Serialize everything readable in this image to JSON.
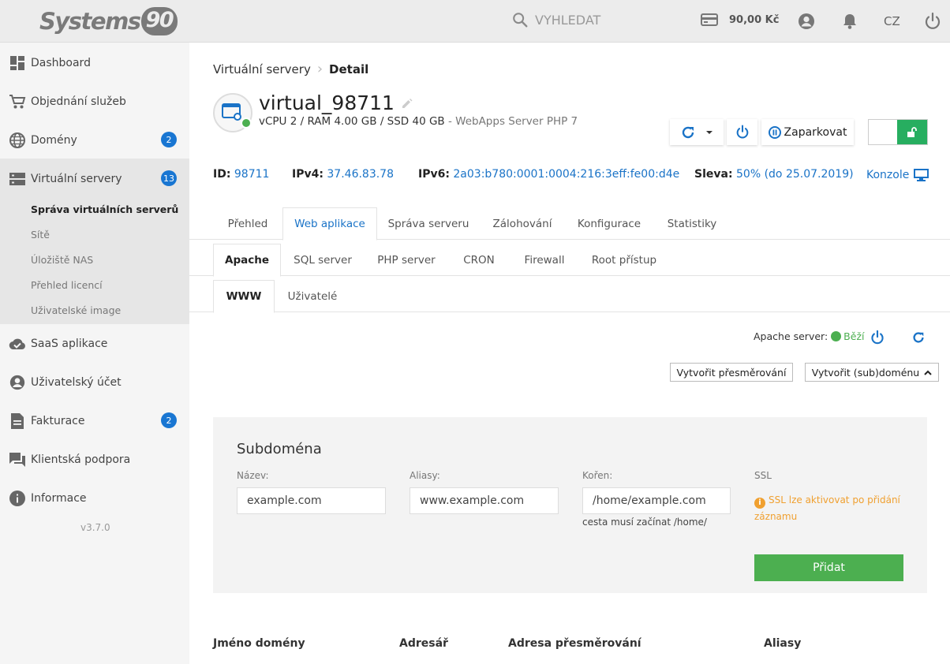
{
  "brand": {
    "logo_text": "Systems",
    "logo_number": "90"
  },
  "topbar": {
    "search_label": "VYHLEDAT",
    "credit": "90,00 Kč",
    "language": "CZ",
    "icons": [
      "search-icon",
      "credit-card-icon",
      "user-icon",
      "bell-icon",
      "power-icon"
    ]
  },
  "sidebar": {
    "items": [
      {
        "label": "Dashboard",
        "icon": "dashboard-icon"
      },
      {
        "label": "Objednání služeb",
        "icon": "cart-icon"
      },
      {
        "label": "Domény",
        "icon": "globe-icon",
        "badge": "2"
      },
      {
        "label": "Virtuální servery",
        "icon": "server-icon",
        "badge": "13"
      },
      {
        "label": "SaaS aplikace",
        "icon": "cloud-icon"
      },
      {
        "label": "Uživatelský účet",
        "icon": "account-icon"
      },
      {
        "label": "Fakturace",
        "icon": "document-icon",
        "badge": "2"
      },
      {
        "label": "Klientská podpora",
        "icon": "chat-icon"
      },
      {
        "label": "Informace",
        "icon": "info-icon"
      }
    ],
    "subitems": [
      {
        "label": "Správa virtuálních serverů",
        "active": true
      },
      {
        "label": "Sítě"
      },
      {
        "label": "Úložiště NAS"
      },
      {
        "label": "Přehled licencí"
      },
      {
        "label": "Uživatelské image"
      }
    ],
    "version": "v3.7.0"
  },
  "breadcrumb": {
    "parent": "Virtuální servery",
    "current": "Detail"
  },
  "server": {
    "name": "virtual_98711",
    "spec": "vCPU 2 / RAM 4.00 GB / SSD 40 GB",
    "spec_extra": " - WebApps Server PHP 7",
    "park_label": "Zaparkovat",
    "info": {
      "id_label": "ID:",
      "id": "98711",
      "ipv4_label": "IPv4:",
      "ipv4": "37.46.83.78",
      "ipv6_label": "IPv6:",
      "ipv6": "2a03:b780:0001:0004:216:3eff:fe00:d4e",
      "discount_label": "Sleva:",
      "discount": "50% (do 25.07.2019)",
      "console": "Konzole"
    }
  },
  "tabs_main": [
    "Přehled",
    "Web aplikace",
    "Správa serveru",
    "Zálohování",
    "Konfigurace",
    "Statistiky"
  ],
  "tabs_sub": [
    "Apache",
    "SQL server",
    "PHP server",
    "CRON",
    "Firewall",
    "Root přístup"
  ],
  "tabs_sub2": [
    "WWW",
    "Uživatelé"
  ],
  "apache": {
    "status_label": "Apache server:",
    "status_value": "Běží",
    "btn_redirect": "Vytvořit přesměrování",
    "btn_subdomain": "Vytvořit (sub)doménu"
  },
  "form": {
    "title": "Subdoména",
    "name_label": "Název:",
    "name_placeholder": "example.com",
    "alias_label": "Aliasy:",
    "alias_placeholder": "www.example.com",
    "root_label": "Kořen:",
    "root_placeholder": "/home/example.com",
    "root_hint": "cesta musí začínat /home/",
    "ssl_label": "SSL",
    "ssl_note": "SSL lze aktivovat po přidání záznamu",
    "submit": "Přidat"
  },
  "table": {
    "headers": [
      "Jméno domény",
      "Adresář",
      "Adresa přesměrování",
      "Aliasy"
    ]
  },
  "colors": {
    "accent": "#1a73c7",
    "success": "#4caf50",
    "warning": "#f0a030",
    "badge": "#1976d2"
  }
}
